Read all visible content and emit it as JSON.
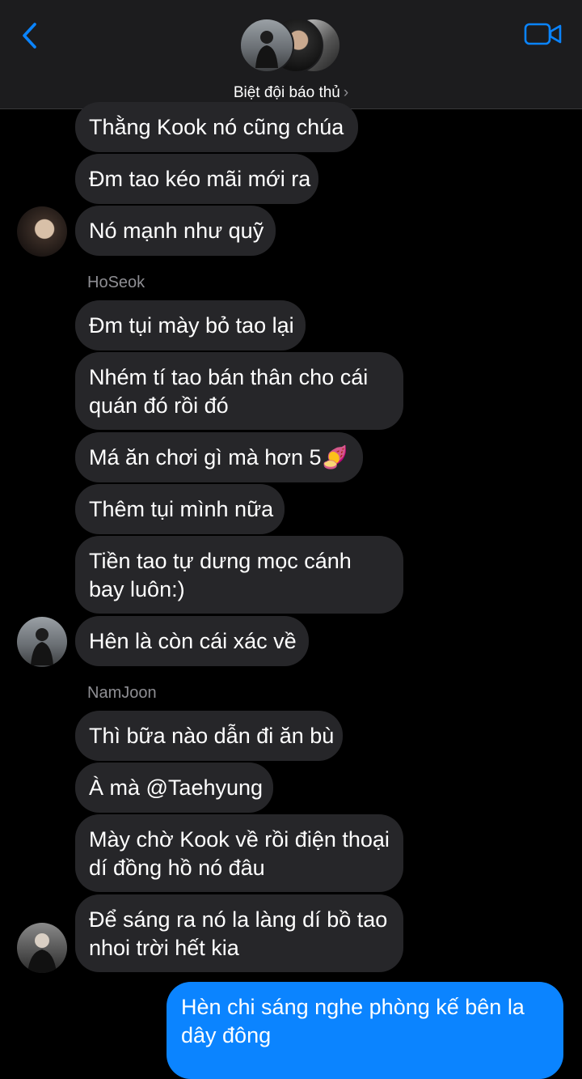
{
  "header": {
    "group_name": "Biệt đội báo thủ",
    "chevron": "›",
    "back_icon": "chevron-left-icon",
    "video_icon": "video-camera-icon",
    "accent": "#0a84ff"
  },
  "messages": [
    {
      "text": "Thằng Kook nó cũng chúa"
    },
    {
      "text": "Đm tao kéo mãi mới ra"
    },
    {
      "text": "Nó mạnh như quỹ"
    },
    {
      "sender": "HoSeok"
    },
    {
      "text": "Đm tụi mày bỏ tao lại"
    },
    {
      "text": "Nhém tí tao bán thân cho cái quán đó rồi đó"
    },
    {
      "text": "Má ăn chơi gì mà hơn 5",
      "emoji": "🍠"
    },
    {
      "text": "Thêm tụi mình nữa"
    },
    {
      "text": "Tiền tao tự dưng mọc cánh bay luôn:)"
    },
    {
      "text": "Hên là còn cái xác về"
    },
    {
      "sender": "NamJoon"
    },
    {
      "text": "Thì bữa nào dẫn đi ăn bù"
    },
    {
      "text": "À mà @Taehyung"
    },
    {
      "text": "Mày chờ Kook về rồi điện thoại dí đồng hồ nó đâu"
    },
    {
      "text": "Để sáng ra nó la làng dí bồ tao nhoi trời hết kia"
    }
  ],
  "outgoing": {
    "text": "Hèn chi sáng nghe phòng kế bên la dây đông",
    "color": "#0b84ff"
  }
}
